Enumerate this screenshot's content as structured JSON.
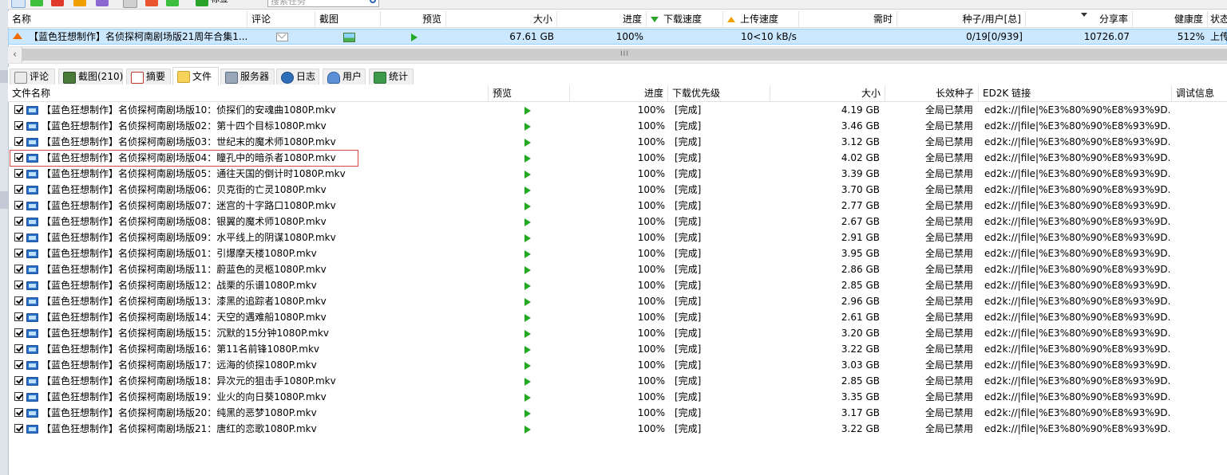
{
  "toolbar": {
    "label_button": "标签",
    "search_placeholder": "搜索任务"
  },
  "task_list": {
    "columns": {
      "name": "名称",
      "comment": "评论",
      "screenshot": "截图",
      "preview": "预览",
      "size": "大小",
      "progress": "进度",
      "download_speed": "下载速度",
      "upload_speed": "上传速度",
      "eta": "需时",
      "seeds_peers": "种子/用户[总]",
      "share_ratio": "分享率",
      "health": "健康度",
      "status": "状态"
    },
    "task": {
      "name": "【蓝色狂想制作】名侦探柯南剧场版21周年合集1...",
      "size": "67.61 GB",
      "progress": "100%",
      "upload_speed": "10<10 kB/s",
      "seeds_peers": "0/19[0/939]",
      "share_ratio": "10726.07",
      "health": "512%",
      "status": "上传"
    },
    "scrollbar_grip": "III"
  },
  "tabs": [
    {
      "label": "评论",
      "icon": "comment-icon"
    },
    {
      "label": "截图(210)",
      "icon": "screenshot-icon"
    },
    {
      "label": "摘要",
      "icon": "summary-icon"
    },
    {
      "label": "文件",
      "icon": "files-icon"
    },
    {
      "label": "服务器",
      "icon": "server-icon"
    },
    {
      "label": "日志",
      "icon": "log-icon"
    },
    {
      "label": "用户",
      "icon": "user-icon"
    },
    {
      "label": "统计",
      "icon": "stats-icon"
    }
  ],
  "file_list": {
    "columns": {
      "filename": "文件名称",
      "preview": "预览",
      "progress": "进度",
      "priority": "下载优先级",
      "size": "大小",
      "longterm_seeds": "长效种子",
      "ed2k": "ED2K 链接",
      "debug": "调试信息"
    },
    "highlighted_row_index": 3,
    "rows": [
      {
        "name": "【蓝色狂想制作】名侦探柯南剧场版10：侦探们的安魂曲1080P.mkv",
        "progress": "100%",
        "priority": "[完成]",
        "size": "4.19 GB",
        "seeds": "全局已禁用",
        "ed2k": "ed2k://|file|%E3%80%90%E8%93%9D..."
      },
      {
        "name": "【蓝色狂想制作】名侦探柯南剧场版02：第十四个目标1080P.mkv",
        "progress": "100%",
        "priority": "[完成]",
        "size": "3.46 GB",
        "seeds": "全局已禁用",
        "ed2k": "ed2k://|file|%E3%80%90%E8%93%9D..."
      },
      {
        "name": "【蓝色狂想制作】名侦探柯南剧场版03：世纪末的魔术师1080P.mkv",
        "progress": "100%",
        "priority": "[完成]",
        "size": "3.12 GB",
        "seeds": "全局已禁用",
        "ed2k": "ed2k://|file|%E3%80%90%E8%93%9D..."
      },
      {
        "name": "【蓝色狂想制作】名侦探柯南剧场版04：瞳孔中的暗杀者1080P.mkv",
        "progress": "100%",
        "priority": "[完成]",
        "size": "4.02 GB",
        "seeds": "全局已禁用",
        "ed2k": "ed2k://|file|%E3%80%90%E8%93%9D..."
      },
      {
        "name": "【蓝色狂想制作】名侦探柯南剧场版05：通往天国的倒计时1080P.mkv",
        "progress": "100%",
        "priority": "[完成]",
        "size": "3.39 GB",
        "seeds": "全局已禁用",
        "ed2k": "ed2k://|file|%E3%80%90%E8%93%9D..."
      },
      {
        "name": "【蓝色狂想制作】名侦探柯南剧场版06：贝克街的亡灵1080P.mkv",
        "progress": "100%",
        "priority": "[完成]",
        "size": "3.70 GB",
        "seeds": "全局已禁用",
        "ed2k": "ed2k://|file|%E3%80%90%E8%93%9D..."
      },
      {
        "name": "【蓝色狂想制作】名侦探柯南剧场版07：迷宫的十字路口1080P.mkv",
        "progress": "100%",
        "priority": "[完成]",
        "size": "2.77 GB",
        "seeds": "全局已禁用",
        "ed2k": "ed2k://|file|%E3%80%90%E8%93%9D..."
      },
      {
        "name": "【蓝色狂想制作】名侦探柯南剧场版08：银翼的魔术师1080P.mkv",
        "progress": "100%",
        "priority": "[完成]",
        "size": "2.67 GB",
        "seeds": "全局已禁用",
        "ed2k": "ed2k://|file|%E3%80%90%E8%93%9D..."
      },
      {
        "name": "【蓝色狂想制作】名侦探柯南剧场版09：水平线上的阴谋1080P.mkv",
        "progress": "100%",
        "priority": "[完成]",
        "size": "2.91 GB",
        "seeds": "全局已禁用",
        "ed2k": "ed2k://|file|%E3%80%90%E8%93%9D..."
      },
      {
        "name": "【蓝色狂想制作】名侦探柯南剧场版01：引爆摩天楼1080P.mkv",
        "progress": "100%",
        "priority": "[完成]",
        "size": "3.95 GB",
        "seeds": "全局已禁用",
        "ed2k": "ed2k://|file|%E3%80%90%E8%93%9D..."
      },
      {
        "name": "【蓝色狂想制作】名侦探柯南剧场版11：蔚蓝色的灵柩1080P.mkv",
        "progress": "100%",
        "priority": "[完成]",
        "size": "2.86 GB",
        "seeds": "全局已禁用",
        "ed2k": "ed2k://|file|%E3%80%90%E8%93%9D..."
      },
      {
        "name": "【蓝色狂想制作】名侦探柯南剧场版12：战栗的乐谱1080P.mkv",
        "progress": "100%",
        "priority": "[完成]",
        "size": "2.85 GB",
        "seeds": "全局已禁用",
        "ed2k": "ed2k://|file|%E3%80%90%E8%93%9D..."
      },
      {
        "name": "【蓝色狂想制作】名侦探柯南剧场版13：漆黑的追踪者1080P.mkv",
        "progress": "100%",
        "priority": "[完成]",
        "size": "2.96 GB",
        "seeds": "全局已禁用",
        "ed2k": "ed2k://|file|%E3%80%90%E8%93%9D..."
      },
      {
        "name": "【蓝色狂想制作】名侦探柯南剧场版14：天空的遇难船1080P.mkv",
        "progress": "100%",
        "priority": "[完成]",
        "size": "2.61 GB",
        "seeds": "全局已禁用",
        "ed2k": "ed2k://|file|%E3%80%90%E8%93%9D..."
      },
      {
        "name": "【蓝色狂想制作】名侦探柯南剧场版15：沉默的15分钟1080P.mkv",
        "progress": "100%",
        "priority": "[完成]",
        "size": "3.20 GB",
        "seeds": "全局已禁用",
        "ed2k": "ed2k://|file|%E3%80%90%E8%93%9D..."
      },
      {
        "name": "【蓝色狂想制作】名侦探柯南剧场版16：第11名前锋1080P.mkv",
        "progress": "100%",
        "priority": "[完成]",
        "size": "3.22 GB",
        "seeds": "全局已禁用",
        "ed2k": "ed2k://|file|%E3%80%90%E8%93%9D..."
      },
      {
        "name": "【蓝色狂想制作】名侦探柯南剧场版17：远海的侦探1080P.mkv",
        "progress": "100%",
        "priority": "[完成]",
        "size": "3.03 GB",
        "seeds": "全局已禁用",
        "ed2k": "ed2k://|file|%E3%80%90%E8%93%9D..."
      },
      {
        "name": "【蓝色狂想制作】名侦探柯南剧场版18：异次元的狙击手1080P.mkv",
        "progress": "100%",
        "priority": "[完成]",
        "size": "2.85 GB",
        "seeds": "全局已禁用",
        "ed2k": "ed2k://|file|%E3%80%90%E8%93%9D..."
      },
      {
        "name": "【蓝色狂想制作】名侦探柯南剧场版19：业火的向日葵1080P.mkv",
        "progress": "100%",
        "priority": "[完成]",
        "size": "3.35 GB",
        "seeds": "全局已禁用",
        "ed2k": "ed2k://|file|%E3%80%90%E8%93%9D..."
      },
      {
        "name": "【蓝色狂想制作】名侦探柯南剧场版20：纯黑的恶梦1080P.mkv",
        "progress": "100%",
        "priority": "[完成]",
        "size": "3.17 GB",
        "seeds": "全局已禁用",
        "ed2k": "ed2k://|file|%E3%80%90%E8%93%9D..."
      },
      {
        "name": "【蓝色狂想制作】名侦探柯南剧场版21：唐红的恋歌1080P.mkv",
        "progress": "100%",
        "priority": "[完成]",
        "size": "3.22 GB",
        "seeds": "全局已禁用",
        "ed2k": "ed2k://|file|%E3%80%90%E8%93%9D..."
      }
    ]
  },
  "colors": {
    "selection_bg": "#cce8ff",
    "play_green": "#22aa22",
    "highlight_red": "#d64545",
    "upload_orange": "#f06a00"
  }
}
